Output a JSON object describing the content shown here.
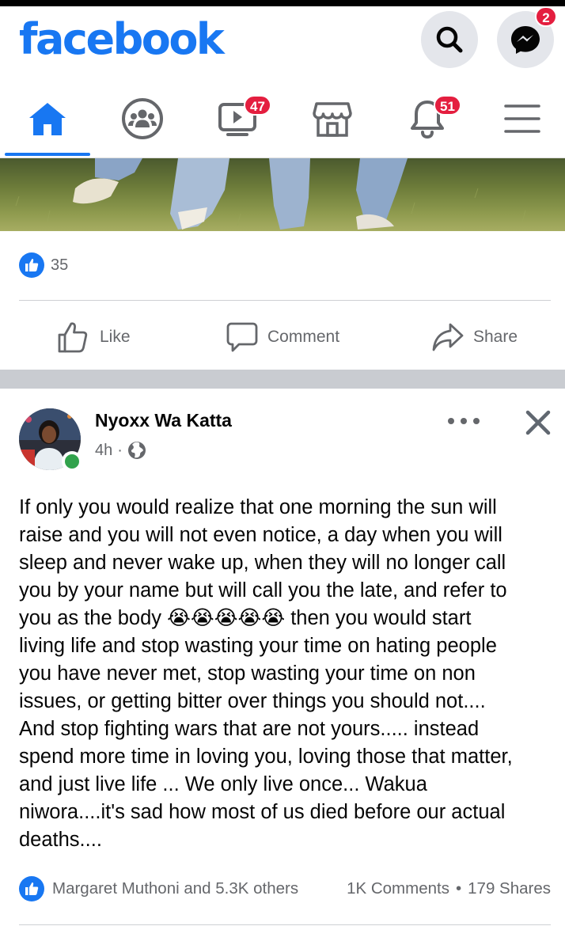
{
  "header": {
    "logo": "facebook",
    "messenger_badge": "2"
  },
  "nav": {
    "watch_badge": "47",
    "notifications_badge": "51"
  },
  "post1": {
    "reaction_count": "35",
    "actions": {
      "like": "Like",
      "comment": "Comment",
      "share": "Share"
    }
  },
  "post2": {
    "author": "Nyoxx Wa Katta",
    "time": "4h",
    "separator": "·",
    "text_part1": "If only you would realize that one morning the sun will\nraise and you will not even notice, a  day when you will\nsleep and never wake up, when they will no longer call\nyou by your name but will call you the late, and refer to\nyou as the body ",
    "emojis": "😭😭😭😭😭",
    "text_part2": " then you would start\nliving life and stop wasting your time on hating people\nyou have never met, stop wasting your time on non\nissues, or getting bitter over things you should not....\nAnd stop fighting wars that are not yours..... instead\nspend more time in loving you, loving those that matter,\nand just live life ... We only live once... Wakua\nniwora....it's sad how most of us died before our actual\ndeaths....",
    "reactions_text": "Margaret Muthoni and 5.3K others",
    "comments": "1K Comments",
    "shares": "179 Shares",
    "stats_separator": "•"
  },
  "colors": {
    "brand": "#1877f2",
    "badge": "#e41e3f",
    "online": "#31a24c",
    "secondary_text": "#65676b"
  },
  "icons": [
    "search-icon",
    "messenger-icon",
    "home-icon",
    "groups-icon",
    "watch-icon",
    "marketplace-icon",
    "bell-icon",
    "menu-icon",
    "like-icon",
    "comment-icon",
    "share-icon",
    "more-icon",
    "close-icon",
    "globe-icon"
  ]
}
